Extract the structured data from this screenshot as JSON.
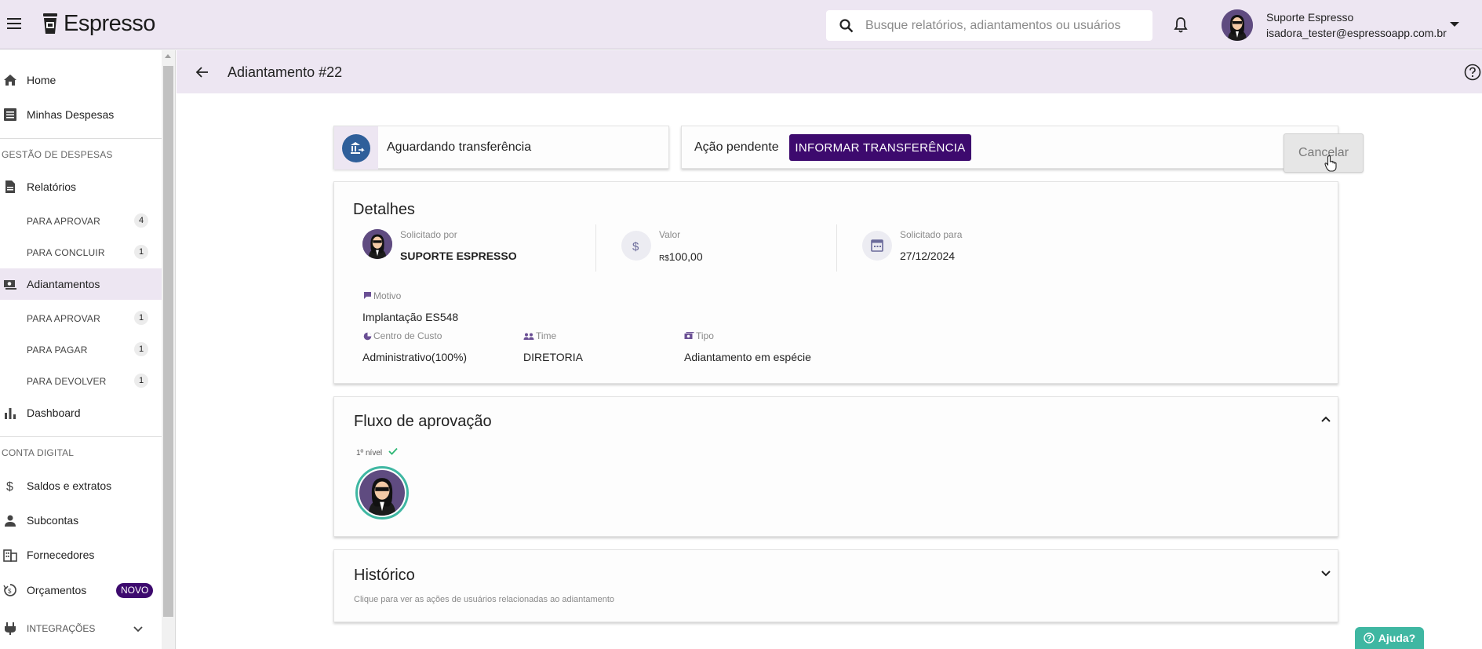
{
  "app": {
    "name": "Espresso",
    "search_placeholder": "Busque relatórios, adiantamentos ou usuários",
    "user_name": "Suporte Espresso",
    "user_email": "isadora_tester@espressoapp.com.br"
  },
  "sidebar": {
    "home": "Home",
    "my_expenses": "Minhas Despesas",
    "section_expenses": "GESTÃO DE DESPESAS",
    "reports": "Relatórios",
    "reports_sub": [
      {
        "label": "PARA APROVAR",
        "count": "4"
      },
      {
        "label": "PARA CONCLUIR",
        "count": "1"
      }
    ],
    "advances": "Adiantamentos",
    "advances_sub": [
      {
        "label": "PARA APROVAR",
        "count": "1"
      },
      {
        "label": "PARA PAGAR",
        "count": "1"
      },
      {
        "label": "PARA DEVOLVER",
        "count": "1"
      }
    ],
    "dashboard": "Dashboard",
    "section_account": "CONTA DIGITAL",
    "balances": "Saldos e extratos",
    "subaccounts": "Subcontas",
    "suppliers": "Fornecedores",
    "budgets": "Orçamentos",
    "budgets_badge": "NOVO",
    "integrations": "INTEGRAÇÕES"
  },
  "page": {
    "title": "Adiantamento #22"
  },
  "status": {
    "text": "Aguardando transferência"
  },
  "action": {
    "label": "Ação pendente",
    "button": "INFORMAR TRANSFERÊNCIA",
    "cancel": "Cancelar"
  },
  "details": {
    "title": "Detalhes",
    "requested_by_label": "Solicitado por",
    "requested_by": "SUPORTE ESPRESSO",
    "value_label": "Valor",
    "currency": "R$",
    "value": "100,00",
    "requested_for_label": "Solicitado para",
    "requested_for": "27/12/2024",
    "reason_label": "Motivo",
    "reason": "Implantação ES548",
    "cost_center_label": "Centro de Custo",
    "cost_center": "Administrativo(100%)",
    "team_label": "Time",
    "team": "DIRETORIA",
    "type_label": "Tipo",
    "type": "Adiantamento em espécie"
  },
  "flow": {
    "title": "Fluxo de aprovação",
    "level": "1º nível"
  },
  "history": {
    "title": "Histórico",
    "hint": "Clique para ver as ações de usuários relacionadas ao adiantamento"
  },
  "help": {
    "label": "Ajuda?"
  },
  "colors": {
    "brand_purple": "#3d0a6e",
    "header_bg": "#ede6f2",
    "status_blue": "#2f5f9a",
    "help_teal": "#3fb7a2",
    "approved_green": "#2bb673"
  }
}
